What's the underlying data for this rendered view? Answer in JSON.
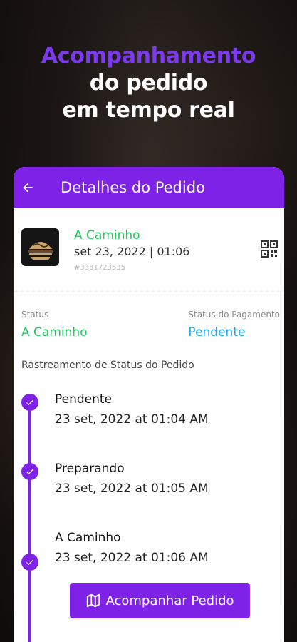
{
  "promo": {
    "line1": "Acompanhamento",
    "line2": "do pedido",
    "line3": "em tempo real"
  },
  "appbar": {
    "title": "Detalhes do Pedido",
    "back_icon": "arrow-left-icon"
  },
  "order": {
    "status": "A Caminho",
    "date": "set 23, 2022 | 01:06",
    "id": "#3381723535",
    "logo_icon": "restaurant-logo",
    "qr_icon": "qr-code-icon"
  },
  "status": {
    "label": "Status",
    "value": "A Caminho",
    "payment_label": "Status do Pagamento",
    "payment_value": "Pendente"
  },
  "tracking": {
    "title": "Rastreamento de Status do Pedido",
    "steps": [
      {
        "name": "Pendente",
        "time": "23 set, 2022 at 01:04 AM"
      },
      {
        "name": "Preparando",
        "time": "23 set, 2022 at 01:05 AM"
      },
      {
        "name": "A Caminho",
        "time": "23 set, 2022 at 01:06 AM"
      }
    ]
  },
  "actions": {
    "track_button": "Acompanhar Pedido",
    "track_icon": "map-icon"
  },
  "colors": {
    "accent": "#7e22e8",
    "success": "#22c55e",
    "info": "#1ea7e8"
  }
}
